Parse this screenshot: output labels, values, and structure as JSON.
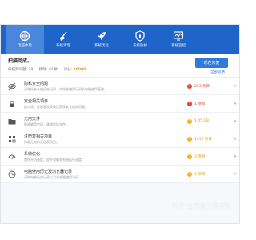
{
  "nav": {
    "tabs": [
      {
        "label": "电脑体检",
        "icon": "crosshair-icon",
        "active": true
      },
      {
        "label": "系统清理",
        "icon": "broom-icon",
        "active": false
      },
      {
        "label": "系统优化",
        "icon": "rocket-icon",
        "active": false
      },
      {
        "label": "系统防护",
        "icon": "shield-icon",
        "active": false
      },
      {
        "label": "系统监控",
        "icon": "monitor-icon",
        "active": false
      }
    ]
  },
  "summary": {
    "title": "扫描完成。",
    "issues_label": "扫描到问题: 79",
    "time_label": "耗时: 40 秒",
    "score_label": "评分:",
    "score": "10000",
    "repair_label": "现在修复",
    "ignore_label": "全部忽略"
  },
  "items": [
    {
      "title": "隐私安全问题",
      "desc": "清除所有系统历史记录、浏览器使用记录及电脑使用痕迹。",
      "status": "253 条目",
      "status_color": "#e0402d",
      "icon": "eye-icon"
    },
    {
      "title": "安全相关项目",
      "desc": "防火墙、注册表及系统设置等安全相关问题。",
      "status": "1 项目",
      "status_color": "#e0402d",
      "icon": "lock-icon"
    },
    {
      "title": "无用文件",
      "desc": "释放磁盘空间，清除垃圾文件。",
      "status": "1.45 GB",
      "status_color": "#f2b01e",
      "icon": "folder-icon"
    },
    {
      "title": "注册表相关项目",
      "desc": "修复无效的注册表项目。",
      "status": "1917 条目",
      "status_color": "#f2b01e",
      "icon": "registry-icon"
    },
    {
      "title": "系统优化",
      "desc": "加快开机速度，提升电脑和系统运行速度。",
      "status": "3 项目",
      "status_color": "#f2b01e",
      "icon": "gauge-icon"
    },
    {
      "title": "电脑使用历史及浏览器记录",
      "desc": "清除电脑历史记录以及浏览器使用记录。",
      "status": "1 项目",
      "status_color": "#f2b01e",
      "icon": "history-icon"
    }
  ],
  "watermark": "知乎 @电脑分享驿站"
}
